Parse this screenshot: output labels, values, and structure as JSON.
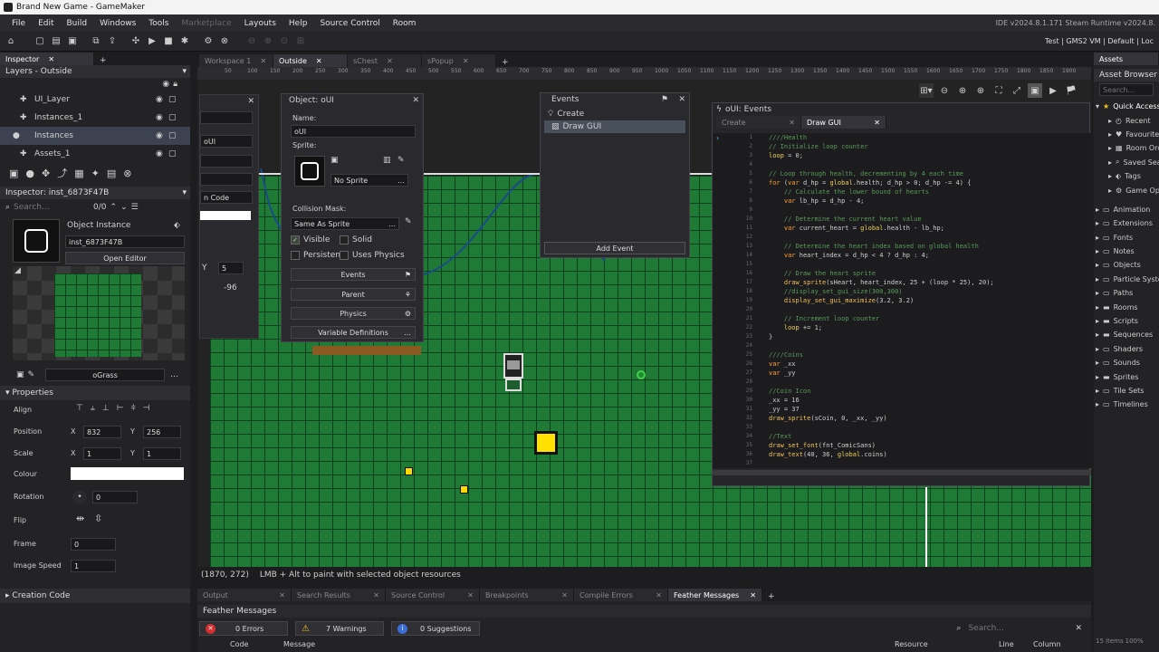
{
  "app": {
    "title": "Brand New Game - GameMaker",
    "version": "IDE v2024.8.1.171 Steam  Runtime v2024.8.",
    "config": "Test | GMS2 VM | Default | Loc"
  },
  "menu": [
    "File",
    "Edit",
    "Build",
    "Windows",
    "Tools",
    "Marketplace",
    "Layouts",
    "Help",
    "Source Control",
    "Room"
  ],
  "inspector": {
    "tab": "Inspector",
    "layers_title": "Layers - Outside",
    "layers": [
      "UI_Layer",
      "Instances_1",
      "Instances",
      "Assets_1"
    ],
    "instance_title": "Inspector: inst_6873F47B",
    "search_placeholder": "Search...",
    "count": "0/0",
    "object_instance": "Object Instance",
    "instance_name": "inst_6873F47B",
    "open_editor": "Open Editor",
    "sprite_name": "oGrass",
    "properties": "Properties",
    "align": "Align",
    "position": "Position",
    "pos_x": "832",
    "pos_y": "256",
    "scale": "Scale",
    "scale_x": "1",
    "scale_y": "1",
    "colour": "Colour",
    "rotation": "Rotation",
    "rotation_val": "0",
    "flip": "Flip",
    "frame": "Frame",
    "frame_val": "0",
    "image_speed": "Image Speed",
    "image_speed_val": "1",
    "creation_code": "Creation Code",
    "x_label": "X",
    "y_label": "Y"
  },
  "workspace_tabs": [
    "Workspace 1",
    "Outside",
    "sChest",
    "sPopup"
  ],
  "partial_panel": {
    "val1": "oUI",
    "code_label": "n Code",
    "y_label": "Y",
    "y_val": "5",
    "val2": "-96"
  },
  "object_panel": {
    "title": "Object: oUI",
    "name_label": "Name:",
    "name": "oUI",
    "sprite_label": "Sprite:",
    "sprite": "No Sprite",
    "mask_label": "Collision Mask:",
    "mask": "Same As Sprite",
    "visible": "Visible",
    "solid": "Solid",
    "persistent": "Persistent",
    "uses_physics": "Uses Physics",
    "events": "Events",
    "parent": "Parent",
    "physics": "Physics",
    "variables": "Variable Definitions"
  },
  "events_panel": {
    "title": "Events",
    "items": [
      "Create",
      "Draw GUI"
    ],
    "add": "Add Event"
  },
  "code_editor": {
    "title": "oUI: Events",
    "tabs": [
      "Create",
      "Draw GUI"
    ]
  },
  "ruler": [
    "50",
    "100",
    "150",
    "200",
    "250",
    "300",
    "350",
    "400",
    "450",
    "500",
    "550",
    "600",
    "650",
    "700",
    "750",
    "800",
    "850",
    "900",
    "950",
    "1000",
    "1050",
    "1100",
    "1150",
    "1200",
    "1250",
    "1300",
    "1350",
    "1400",
    "1450",
    "1500",
    "1550",
    "1600",
    "1650",
    "1700",
    "1750",
    "1800",
    "1850",
    "1900"
  ],
  "status": {
    "coords": "(1870, 272)",
    "hint": "LMB + Alt to paint with selected object resources"
  },
  "bottom_tabs": [
    "Output",
    "Search Results",
    "Source Control",
    "Breakpoints",
    "Compile Errors",
    "Feather Messages"
  ],
  "feather": {
    "title": "Feather Messages",
    "errors": "0 Errors",
    "warnings": "7 Warnings",
    "suggestions": "0 Suggestions",
    "search_placeholder": "Search...",
    "cols": [
      "Code",
      "Message",
      "Resource",
      "Line",
      "Column"
    ]
  },
  "assets": {
    "tab": "Assets",
    "browser": "Asset Browser",
    "search_placeholder": "Search...",
    "quick": "Quick Access",
    "quick_items": [
      "Recent",
      "Favourites",
      "Room Order",
      "Saved Searches",
      "Tags",
      "Game Options"
    ],
    "groups": [
      "Animation",
      "Extensions",
      "Fonts",
      "Notes",
      "Objects",
      "Particle Systems",
      "Paths",
      "Rooms",
      "Scripts",
      "Sequences",
      "Shaders",
      "Sounds",
      "Sprites",
      "Tile Sets",
      "Timelines"
    ],
    "footer": "15 items",
    "zoom": "100%"
  }
}
